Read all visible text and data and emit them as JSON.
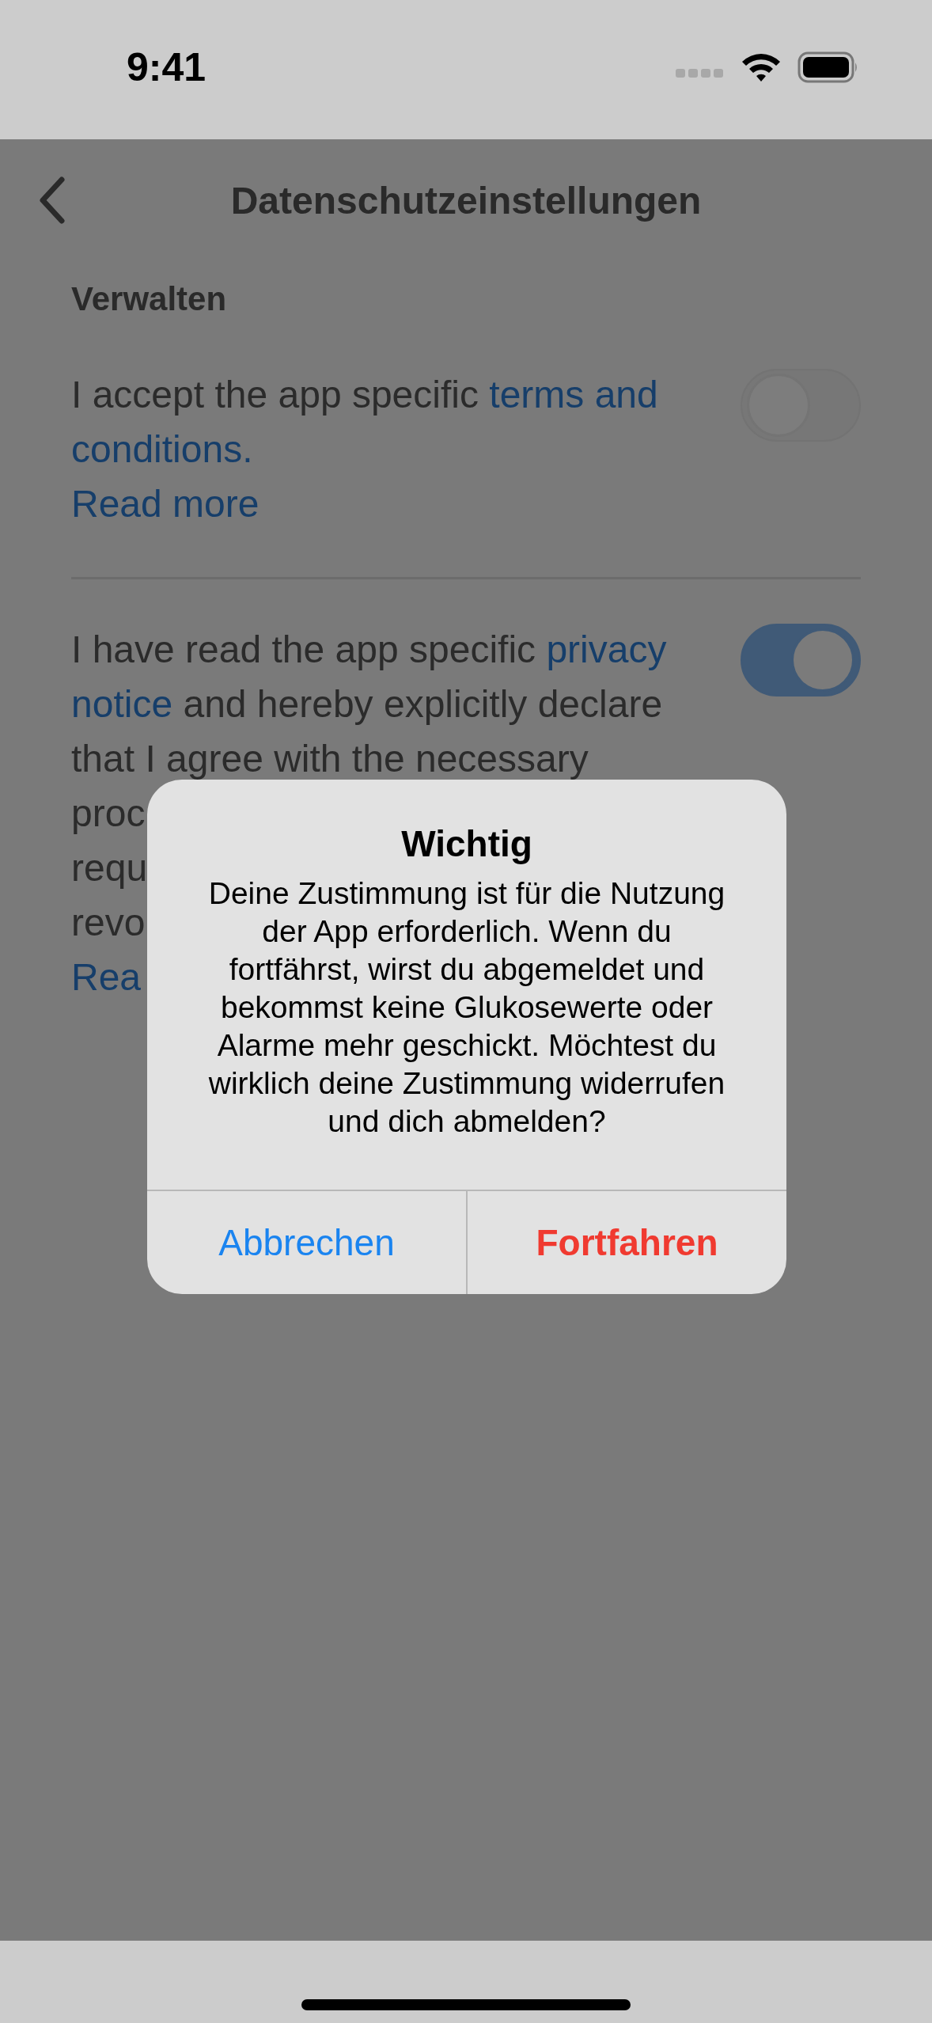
{
  "status_bar": {
    "time": "9:41"
  },
  "header": {
    "title": "Datenschutzeinstellungen"
  },
  "section": {
    "title": "Verwalten"
  },
  "consents": [
    {
      "on": false,
      "lines": [
        [
          {
            "kind": "plain",
            "text": "I accept the app specific "
          },
          {
            "kind": "link",
            "text": "terms and"
          }
        ],
        [
          {
            "kind": "link",
            "text": "conditions."
          }
        ]
      ],
      "read_more": "Read more"
    },
    {
      "on": true,
      "lines": [
        [
          {
            "kind": "plain",
            "text": "I have read the app specific "
          },
          {
            "kind": "link",
            "text": "privacy"
          }
        ],
        [
          {
            "kind": "link",
            "text": "notice"
          },
          {
            "kind": "plain",
            "text": " and hereby explicitly declare"
          }
        ],
        [
          {
            "kind": "plain",
            "text": "that I agree with the necessary"
          }
        ],
        [
          {
            "kind": "plain",
            "text": "proc"
          }
        ],
        [
          {
            "kind": "plain",
            "text": "requ"
          }
        ],
        [
          {
            "kind": "plain",
            "text": "revo"
          }
        ]
      ],
      "read_more": "Rea"
    }
  ],
  "dialog": {
    "title": "Wichtig",
    "message": "Deine Zustimmung ist für die Nutzung der App erforderlich. Wenn du fortfährst, wirst du abgemeldet und bekommst keine Glukosewerte oder Alarme mehr geschickt. Möchtest du wirklich deine Zustimmung widerrufen und dich abmelden?",
    "buttons": [
      {
        "label": "Abbrechen",
        "kind": "cancel"
      },
      {
        "label": "Fortfahren",
        "kind": "destructive"
      }
    ]
  }
}
